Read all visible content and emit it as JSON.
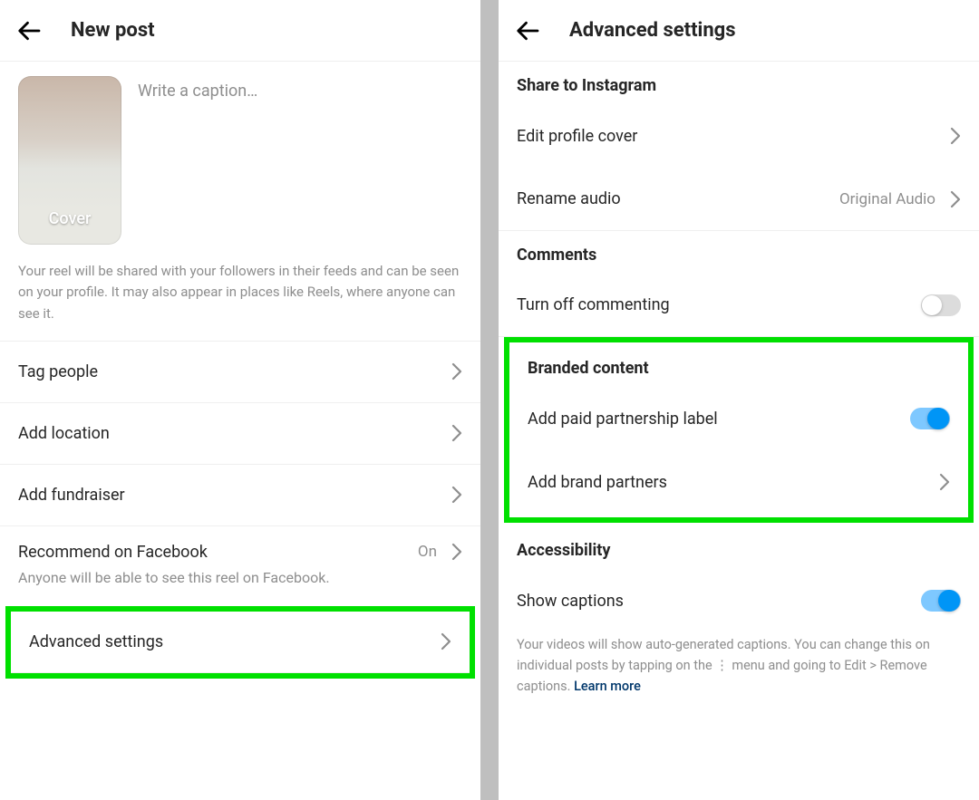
{
  "left": {
    "title": "New post",
    "cover_label": "Cover",
    "caption_placeholder": "Write a caption…",
    "info_paragraph": "Your reel will be shared with your followers in their feeds and can be seen on your profile. It may also appear in places like Reels, where anyone can see it.",
    "rows": {
      "tag_people": "Tag people",
      "add_location": "Add location",
      "add_fundraiser": "Add fundraiser",
      "recommend_fb": "Recommend on Facebook",
      "recommend_fb_value": "On",
      "recommend_fb_sub": "Anyone will be able to see this reel on Facebook.",
      "advanced_settings": "Advanced settings"
    }
  },
  "right": {
    "title": "Advanced settings",
    "sections": {
      "share_instagram": {
        "header": "Share to Instagram",
        "edit_profile_cover": "Edit profile cover",
        "rename_audio": "Rename audio",
        "rename_audio_value": "Original Audio"
      },
      "comments": {
        "header": "Comments",
        "turn_off_commenting": "Turn off commenting",
        "toggle_on": false
      },
      "branded": {
        "header": "Branded content",
        "paid_partnership": "Add paid partnership label",
        "paid_partnership_on": true,
        "brand_partners": "Add brand partners"
      },
      "accessibility": {
        "header": "Accessibility",
        "show_captions": "Show captions",
        "show_captions_on": true,
        "footnote_pre": "Your videos will show auto-generated captions. You can change this on individual posts by tapping on the ⋮ menu and going to Edit > Remove captions. ",
        "learn_more": "Learn more"
      }
    }
  }
}
